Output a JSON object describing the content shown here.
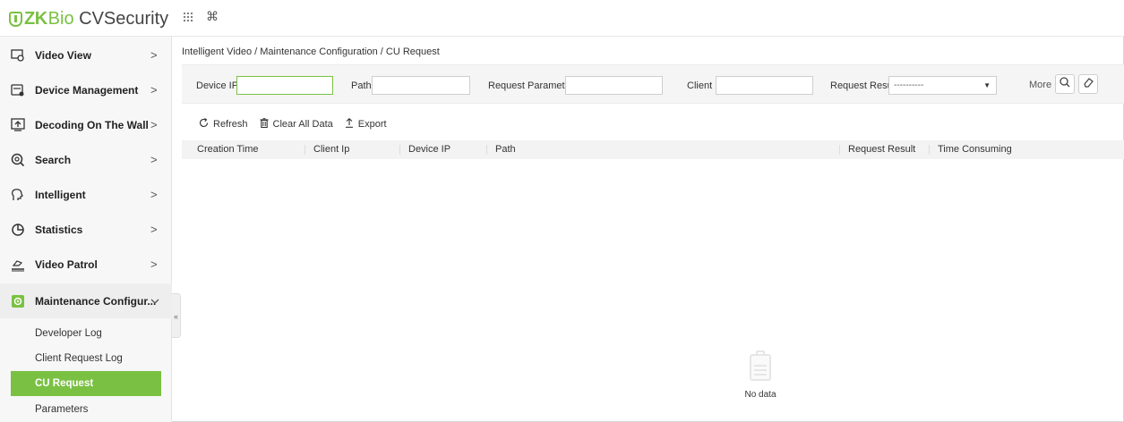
{
  "app": {
    "logo_brand": "ZK",
    "logo_bio": "Bio",
    "logo_product": " CVSecurity",
    "grid_icon": "apps-grid-icon",
    "cmd_icon": "command-icon"
  },
  "sidebar": {
    "items": [
      {
        "label": "Video View",
        "icon": "video-view-icon",
        "arrow": ">"
      },
      {
        "label": "Device Management",
        "icon": "device-management-icon",
        "arrow": ">"
      },
      {
        "label": "Decoding On The Wall",
        "icon": "decoding-wall-icon",
        "arrow": ">"
      },
      {
        "label": "Search",
        "icon": "search-icon",
        "arrow": ">"
      },
      {
        "label": "Intelligent",
        "icon": "intelligent-icon",
        "arrow": ">"
      },
      {
        "label": "Statistics",
        "icon": "statistics-icon",
        "arrow": ">"
      },
      {
        "label": "Video Patrol",
        "icon": "video-patrol-icon",
        "arrow": ">"
      },
      {
        "label": "Maintenance Configur...",
        "icon": "maintenance-icon",
        "arrow": "v"
      }
    ],
    "sub_items": [
      {
        "label": "Developer Log"
      },
      {
        "label": "Client Request Log"
      },
      {
        "label": "CU Request"
      },
      {
        "label": "Parameters"
      }
    ],
    "collapse_glyph": "«"
  },
  "main": {
    "breadcrumb": "Intelligent Video / Maintenance Configuration / CU Request",
    "filters": {
      "device_ip_label": "Device IP",
      "device_ip_value": "",
      "path_label": "Path",
      "path_value": "",
      "request_parameter_label": "Request Parameter",
      "request_parameter_value": "",
      "client_ip_label": "Client Ip",
      "client_ip_value": "",
      "request_result_label": "Request Result",
      "request_result_value": "----------",
      "more_label": "More"
    },
    "toolbar": {
      "refresh_label": "Refresh",
      "clear_label": "Clear All Data",
      "export_label": "Export"
    },
    "table": {
      "columns": [
        "Creation Time",
        "Client Ip",
        "Device IP",
        "Path",
        "Request Result",
        "Time Consuming"
      ],
      "rows": []
    },
    "empty_text": "No data"
  },
  "colors": {
    "accent": "#7ac143",
    "sidebar_bg": "#f7f7f7"
  }
}
